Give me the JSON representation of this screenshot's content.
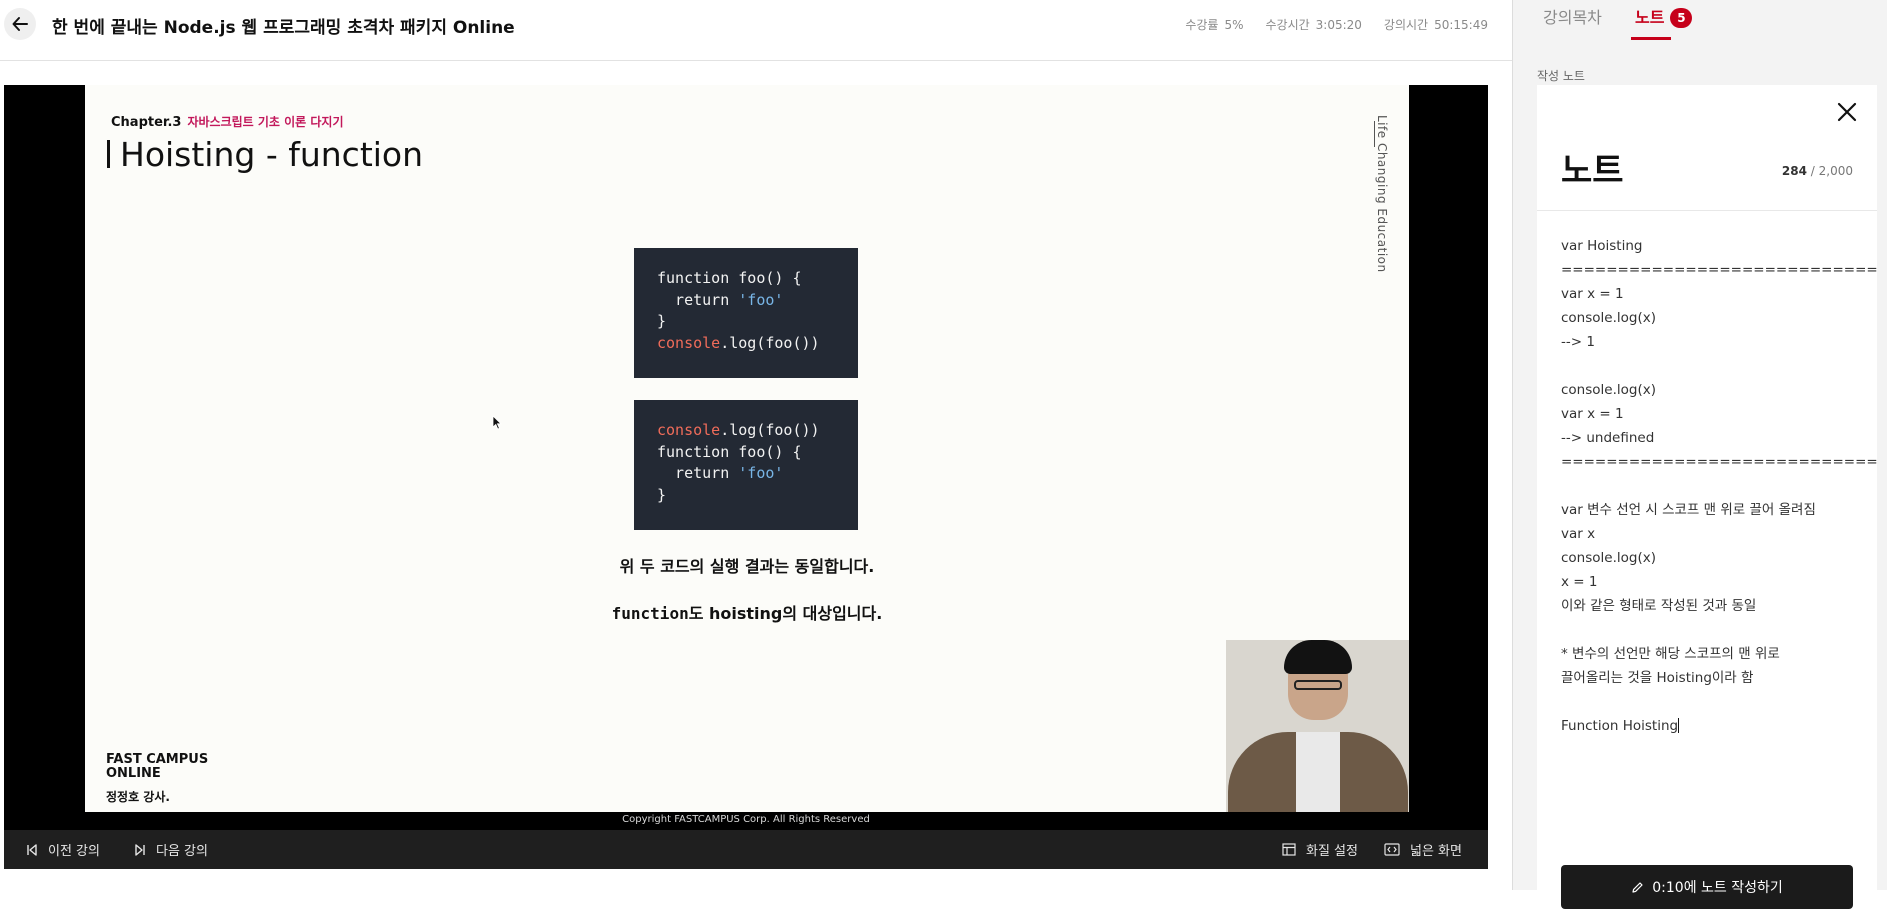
{
  "header": {
    "title": "한 번에 끝내는 Node.js 웹 프로그래밍 초격차 패키지 Online",
    "stats": [
      {
        "label": "수강률",
        "value": "5%"
      },
      {
        "label": "수강시간",
        "value": "3:05:20"
      },
      {
        "label": "강의시간",
        "value": "50:15:49"
      }
    ]
  },
  "slide": {
    "chapter_num": "Chapter.3",
    "chapter_sub": "자바스크립트 기초 이론 다지기",
    "title": "Hoisting - function",
    "brand_vertical": "Life Changing Education",
    "caption1": "위 두 코드의 실행 결과는 동일합니다.",
    "caption2_code": "function",
    "caption2_text": "도 hoisting의 대상입니다.",
    "logo_line1": "FAST CAMPUS",
    "logo_line2": "ONLINE",
    "instructor": "정정호 강사.",
    "copyright": "Copyright FASTCAMPUS Corp. All Rights Reserved"
  },
  "controls": {
    "prev_label": "이전 강의",
    "next_label": "다음 강의",
    "quality_label": "화질 설정",
    "wide_label": "넓은 화면"
  },
  "sidebar": {
    "tab_toc": "강의목차",
    "tab_notes": "노트",
    "notes_badge": "5",
    "section_label": "작성 노트",
    "note_title": "노트",
    "char_current": "284",
    "char_max": "/ 2,000",
    "note_text": "var Hoisting\n============================\nvar x = 1\nconsole.log(x)\n--> 1\n\nconsole.log(x)\nvar x = 1\n--> undefined\n============================\n\nvar 변수 선언 시 스코프 맨 위로 끌어 올려짐\nvar x\nconsole.log(x)\nx = 1\n이와 같은 형태로 작성된 것과 동일\n\n* 변수의 선언만 해당 스코프의 맨 위로\n끌어올리는 것을 Hoisting이라 함\n\nFunction Hoisting",
    "save_label": "0:10에 노트 작성하기"
  },
  "icons": [
    "back-arrow-icon",
    "close-icon",
    "prev-lecture-icon",
    "next-lecture-icon",
    "quality-settings-icon",
    "wide-screen-icon",
    "pencil-icon",
    "mouse-cursor-icon"
  ],
  "colors": {
    "accent": "#c6001a",
    "chapter_sub": "#c2185b",
    "code_bg": "#232934",
    "code_keyword": "#f06c5a",
    "code_string": "#78b5e6"
  }
}
